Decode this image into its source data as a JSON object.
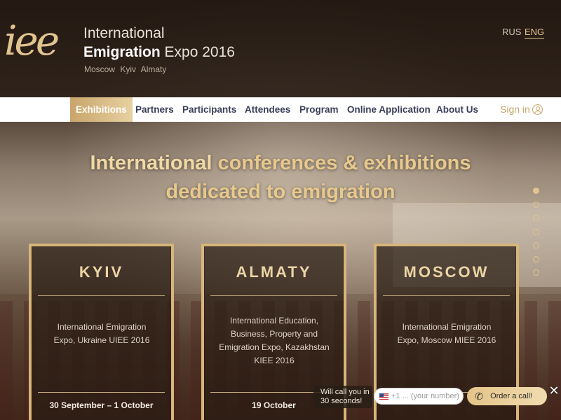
{
  "brand": {
    "logo_text": "iee",
    "title_line1": "International",
    "title_line2_bold": "Emigration",
    "title_line2_rest": " Expo 2016",
    "cities": "Moscow  Kyiv  Almaty"
  },
  "languages": {
    "rus": "RUS",
    "eng": "ENG",
    "active": "ENG"
  },
  "nav": {
    "items": [
      "Exhibitions",
      "Partners",
      "Participants",
      "Attendees",
      "Program",
      "Online Application",
      "About Us"
    ],
    "active": "Exhibitions",
    "sign_in": "Sign in"
  },
  "hero": {
    "line1_strong": "International",
    "line1_rest": " conferences & exhibitions",
    "line2": "dedicated to emigration"
  },
  "slider": {
    "count": 7,
    "active_index": 0
  },
  "cards": [
    {
      "city": "KYIV",
      "description": "International Emigration Expo, Ukraine UIEE 2016",
      "date": "30 September – 1 October"
    },
    {
      "city": "ALMATY",
      "description": "International Education, Business, Property and Emigration Expo, Kazakhstan KIEE 2016",
      "date": "19 October"
    },
    {
      "city": "MOSCOW",
      "description": "International Emigration Expo, Moscow MIEE 2016",
      "date": ""
    }
  ],
  "callback": {
    "prompt": "Will call you in 30 seconds!",
    "phone_placeholder": "+1 ... (your number)",
    "order_label": "Order a call!",
    "close_symbol": "✕"
  },
  "colors": {
    "gold": "#d8b57a",
    "nav_text": "#3a3f57",
    "active_nav": "#c9a56a"
  }
}
